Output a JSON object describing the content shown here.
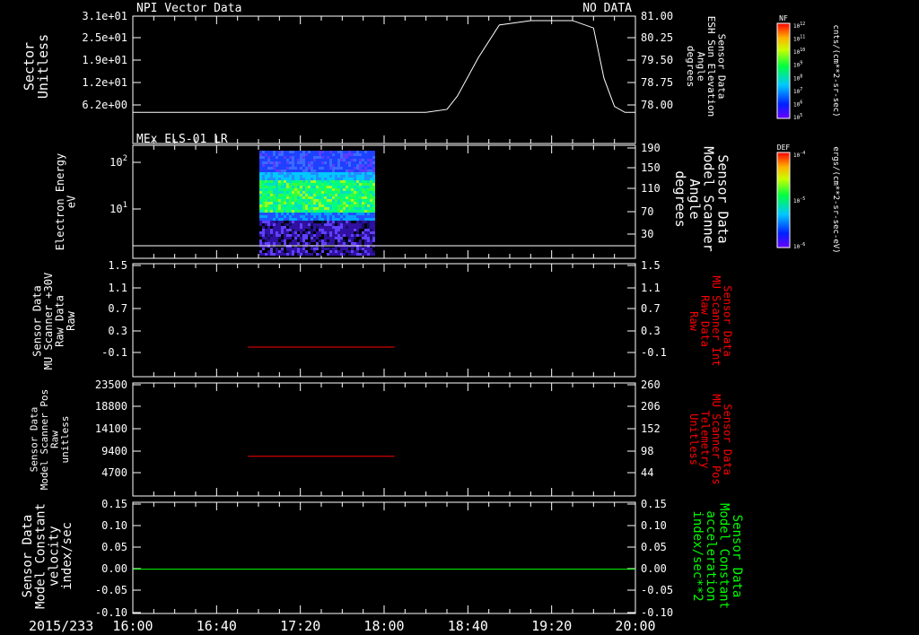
{
  "colors": {
    "bg": "#000000",
    "fg": "#ffffff",
    "red": "#ff0000",
    "green": "#00ff00"
  },
  "chart_data": [
    {
      "type": "line",
      "title": "NPI Vector Data",
      "status": "NO DATA",
      "ylabel_left": [
        "Sector",
        "Unitless"
      ],
      "left_ticks": [
        "3.1e+01",
        "2.5e+01",
        "1.9e+01",
        "1.2e+01",
        "6.2e+00"
      ],
      "ylabel_right": [
        "Sensor Data",
        "ESH Sun Elevation",
        "Angle",
        "degrees"
      ],
      "right_ticks": [
        "81.00",
        "80.25",
        "79.50",
        "78.75",
        "78.00"
      ],
      "right_range": [
        77.7,
        81.0
      ],
      "series": [
        {
          "color": "#ffffff",
          "x": [
            "16:00",
            "17:00",
            "18:00",
            "18:20",
            "18:30",
            "18:35",
            "18:45",
            "18:55",
            "19:10",
            "19:30",
            "19:40",
            "19:45",
            "19:50",
            "19:55",
            "20:00"
          ],
          "y": [
            77.75,
            77.75,
            77.75,
            77.75,
            77.85,
            78.3,
            79.6,
            80.7,
            80.85,
            80.85,
            80.6,
            78.9,
            77.95,
            77.75,
            77.75
          ]
        }
      ]
    },
    {
      "type": "heatmap",
      "title": "MEx ELS-01 LR",
      "ylabel_left": [
        "Electron Energy",
        "eV"
      ],
      "left_ticks": [
        "10",
        "10"
      ],
      "left_tick_exponents": [
        "2",
        "1"
      ],
      "ylabel_right": [
        "Sensor Data",
        "Model Scanner",
        "Angle",
        "degrees"
      ],
      "right_ticks": [
        "190",
        "150",
        "110",
        "70",
        "30"
      ],
      "x_range": [
        "17:00",
        "17:55"
      ],
      "description_bands": [
        "low energy dark blue",
        "mid energy green",
        "high energy blue"
      ]
    },
    {
      "type": "line",
      "ylabel_left": [
        "Sensor Data",
        "MU Scanner +30V",
        "Raw Data",
        "Raw"
      ],
      "left_ticks": [
        "1.5",
        "1.1",
        "0.7",
        "0.3",
        "-0.1"
      ],
      "ylabel_right": [
        "Sensor Data",
        "MU Scanner Int",
        "Raw Data",
        "Raw"
      ],
      "right_ticks": [
        "1.5",
        "1.1",
        "0.7",
        "0.3",
        "-0.1"
      ],
      "ylim": [
        -0.5,
        1.5
      ],
      "series": [
        {
          "color": "#ff0000",
          "x": [
            "16:55",
            "18:05"
          ],
          "y": [
            0.0,
            0.0
          ]
        }
      ]
    },
    {
      "type": "line",
      "ylabel_left": [
        "Sensor Data",
        "Model Scanner Pos",
        "Raw",
        "unitless"
      ],
      "left_ticks": [
        "23500",
        "18800",
        "14100",
        "9400",
        "4700"
      ],
      "ylabel_right": [
        "Sensor Data",
        "MU Scanner Pos",
        "Telemetry",
        "Unitless"
      ],
      "right_ticks": [
        "260",
        "206",
        "152",
        "98",
        "44"
      ],
      "ylim": [
        0,
        23500
      ],
      "series": [
        {
          "color": "#ff0000",
          "x": [
            "16:55",
            "18:05"
          ],
          "y": [
            8200,
            8200
          ]
        }
      ]
    },
    {
      "type": "line",
      "ylabel_left": [
        "Sensor Data",
        "Model Constant",
        "velocity",
        "index/sec"
      ],
      "left_ticks": [
        "0.15",
        "0.10",
        "0.05",
        "0.00",
        "-0.05",
        "-0.10"
      ],
      "ylabel_right": [
        "Sensor Data",
        "Model Constant",
        "acceleration",
        "index/sec**2"
      ],
      "right_ticks": [
        "0.15",
        "0.10",
        "0.05",
        "0.00",
        "-0.05",
        "-0.10"
      ],
      "ylim": [
        -0.1,
        0.15
      ],
      "series": [
        {
          "color": "#00ff00",
          "x": [
            "16:00",
            "20:00"
          ],
          "y": [
            0.0,
            0.0
          ]
        }
      ]
    }
  ],
  "x_axis": {
    "date": "2015/233",
    "ticks": [
      "16:00",
      "16:40",
      "17:20",
      "18:00",
      "18:40",
      "19:20",
      "20:00"
    ],
    "range": [
      "16:00",
      "20:00"
    ]
  },
  "colorbars": [
    {
      "label": "NF",
      "units": "cnts/(cm**2-sr-sec)",
      "tick_base": "10",
      "tick_exps": [
        "12",
        "11",
        "10",
        "9",
        "8",
        "7",
        "6",
        "5"
      ]
    },
    {
      "label": "DEF",
      "units": "ergs/(cm**2-sr-sec-eV)",
      "tick_base": "10",
      "tick_exps": [
        "-4",
        "-5",
        "-6"
      ]
    }
  ]
}
